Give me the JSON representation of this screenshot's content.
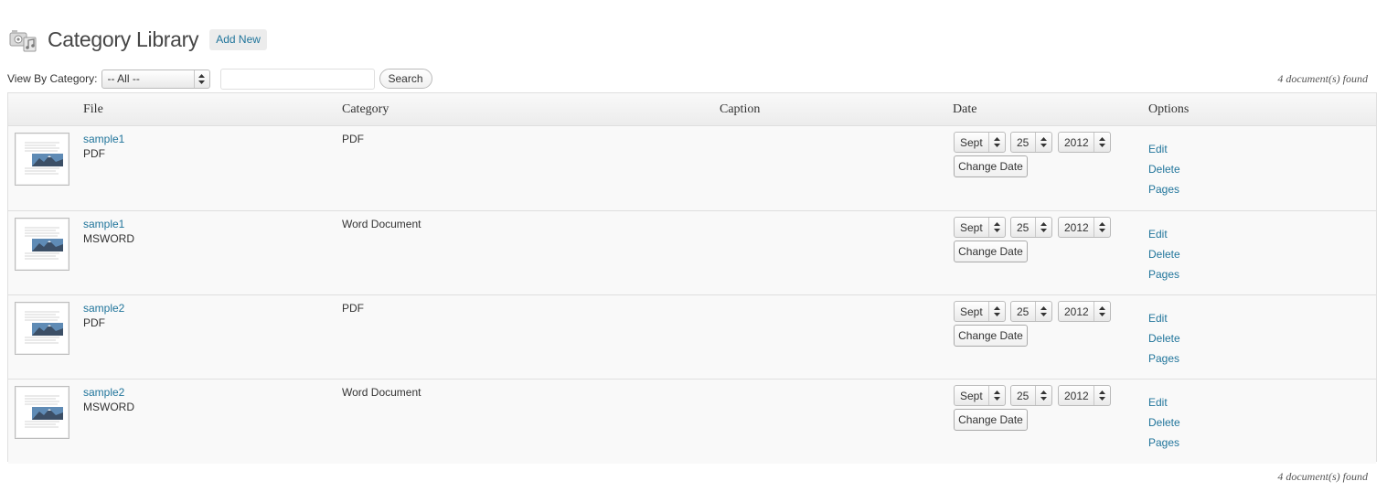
{
  "header": {
    "title": "Category Library",
    "add_new": "Add New",
    "icon": "media-library-icon"
  },
  "filter": {
    "label": "View By Category:",
    "selected": "-- All --",
    "search_value": "",
    "search_button": "Search",
    "found_text": "4 document(s) found"
  },
  "table": {
    "columns": [
      "File",
      "Category",
      "Caption",
      "Date",
      "Options"
    ],
    "rows": [
      {
        "name": "sample1",
        "type": "PDF",
        "category": "PDF",
        "caption": "",
        "month": "Sept",
        "day": "25",
        "year": "2012"
      },
      {
        "name": "sample1",
        "type": "MSWORD",
        "category": "Word Document",
        "caption": "",
        "month": "Sept",
        "day": "25",
        "year": "2012"
      },
      {
        "name": "sample2",
        "type": "PDF",
        "category": "PDF",
        "caption": "",
        "month": "Sept",
        "day": "25",
        "year": "2012"
      },
      {
        "name": "sample2",
        "type": "MSWORD",
        "category": "Word Document",
        "caption": "",
        "month": "Sept",
        "day": "25",
        "year": "2012"
      }
    ],
    "change_date_label": "Change Date",
    "options": [
      "Edit",
      "Delete",
      "Pages"
    ]
  },
  "footer": {
    "found_text": "4 document(s) found"
  },
  "colors": {
    "link": "#21759b",
    "row_bg": "#f9f9f9",
    "border": "#dfdfdf"
  }
}
